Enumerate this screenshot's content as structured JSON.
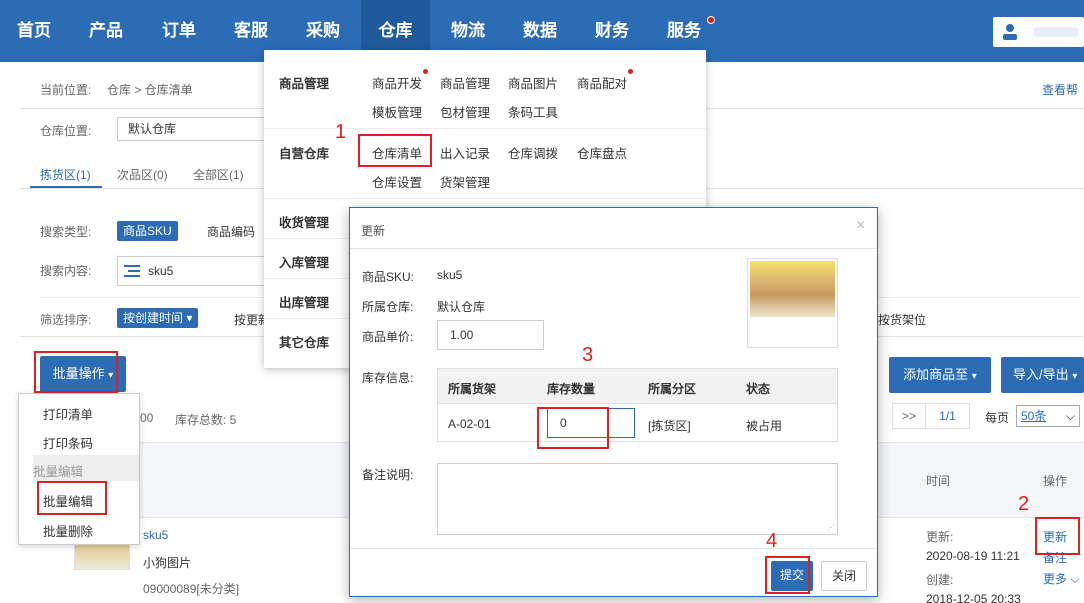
{
  "nav": {
    "items": [
      "首页",
      "产品",
      "订单",
      "客服",
      "采购",
      "仓库",
      "物流",
      "数据",
      "财务",
      "服务"
    ],
    "active": "仓库"
  },
  "breadcrumb": {
    "label": "当前位置:",
    "path": "仓库 > 仓库清单",
    "help": "查看帮"
  },
  "warehouse": {
    "label": "仓库位置:",
    "selected": "默认仓库"
  },
  "zone_tabs": [
    "拣货区(1)",
    "次品区(0)",
    "全部区(1)"
  ],
  "search": {
    "type_label": "搜索类型:",
    "type_selected": "商品SKU",
    "type_other": "商品编码",
    "content_label": "搜索内容:",
    "content_value": "sku5"
  },
  "filter": {
    "label": "筛选排序:",
    "selected": "按创建时间 ▾",
    "option2": "按更新",
    "option_right": "按货架位"
  },
  "toolbar": {
    "batch_button": "批量操作",
    "add_to": "添加商品至",
    "import_export": "导入/导出",
    "count_prefix": "00",
    "stock_total": "库存总数: 5"
  },
  "pager": {
    "next": ">>",
    "page": "1/1",
    "per_page_label": "每页",
    "per_page_value": "50条"
  },
  "table": {
    "col_time": "时间",
    "col_action": "操作",
    "row": {
      "sku": "sku5",
      "name": "小狗图片",
      "code": "09000089[未分类]",
      "updated_label": "更新:",
      "updated": "2020-08-19 11:21",
      "created_label": "创建:",
      "created": "2018-12-05 20:33",
      "action_update": "更新",
      "action_note": "备注",
      "action_more": "更多"
    }
  },
  "batch_dropdown": {
    "items": [
      "打印清单",
      "打印条码"
    ],
    "section": "批量编辑",
    "edit": "批量编辑",
    "delete": "批量删除"
  },
  "megamenu": {
    "categories": [
      "商品管理",
      "自营仓库",
      "收货管理",
      "入库管理",
      "出库管理",
      "其它仓库"
    ],
    "goods": [
      "商品开发",
      "商品管理",
      "商品图片",
      "商品配对",
      "模板管理",
      "包材管理",
      "条码工具"
    ],
    "own": [
      "仓库清单",
      "出入记录",
      "仓库调拨",
      "仓库盘点",
      "仓库设置",
      "货架管理"
    ]
  },
  "modal": {
    "title": "更新",
    "close": "×",
    "sku_label": "商品SKU:",
    "sku_value": "sku5",
    "warehouse_label": "所属仓库:",
    "warehouse_value": "默认仓库",
    "price_label": "商品单价:",
    "price_value": "1.00",
    "stock_label": "库存信息:",
    "stock_headers": [
      "所属货架",
      "库存数量",
      "所属分区",
      "状态"
    ],
    "stock_row": {
      "shelf": "A-02-01",
      "qty": "0",
      "zone": "[拣货区]",
      "status": "被占用"
    },
    "note_label": "备注说明:",
    "submit": "提交",
    "close_btn": "关闭"
  },
  "annotations": [
    "1",
    "2",
    "3",
    "4"
  ],
  "colors": {
    "primary": "#2b6cb5",
    "annotation": "#e02020"
  }
}
